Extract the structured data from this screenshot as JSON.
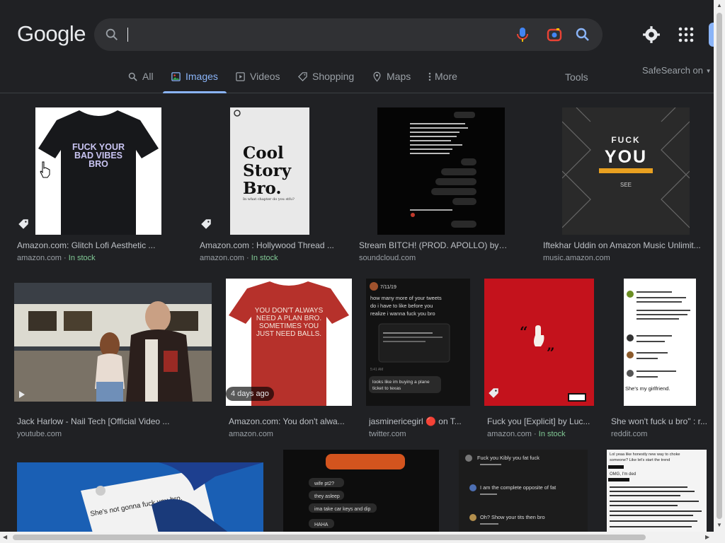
{
  "header": {
    "logo": "Google",
    "search": {
      "value": "",
      "placeholder": ""
    }
  },
  "tabs": [
    {
      "label": "All",
      "icon": "search-icon"
    },
    {
      "label": "Images",
      "icon": "image-icon",
      "active": true
    },
    {
      "label": "Videos",
      "icon": "play-icon"
    },
    {
      "label": "Shopping",
      "icon": "tag-icon"
    },
    {
      "label": "Maps",
      "icon": "map-pin-icon"
    },
    {
      "label": "More",
      "icon": "more-vert-icon"
    }
  ],
  "tools_label": "Tools",
  "safesearch_label": "SafeSearch on",
  "results": [
    {
      "title": "Amazon.com: Glitch Lofi Aesthetic ...",
      "source": "amazon.com",
      "stock": "In stock",
      "thumb_text": [
        "FUCK YOUR",
        "BAD VIBES",
        "BRO"
      ]
    },
    {
      "title": "Amazon.com : Hollywood Thread ...",
      "source": "amazon.com",
      "stock": "In stock",
      "thumb_text": [
        "Cool",
        "Story",
        "Bro.",
        "In what chapter do you stfu?"
      ]
    },
    {
      "title": "Stream BITCH! (PROD. APOLLO) by ...",
      "source": "soundcloud.com",
      "stock": ""
    },
    {
      "title": "Iftekhar Uddin on Amazon Music Unlimit...",
      "source": "music.amazon.com",
      "stock": "",
      "thumb_text": [
        "FUCK",
        "YOU",
        "SEE"
      ]
    },
    {
      "title": "Jack Harlow - Nail Tech [Official Video ...",
      "source": "youtube.com",
      "stock": ""
    },
    {
      "title": "Amazon.com: You don't alwa...",
      "source": "amazon.com",
      "stock": "",
      "badge": "4 days ago",
      "thumb_text": [
        "YOU DON'T ALWAYS",
        "NEED A PLAN BRO.",
        "SOMETIMES YOU",
        "JUST NEED BALLS."
      ]
    },
    {
      "title": "jasminericegirl 🔴 on T...",
      "source": "twitter.com",
      "stock": "",
      "thumb_text": [
        "how many more of your tweets",
        "do i have to like before you",
        "realize i wanna fuck you bro",
        "looks like im buying a plane",
        "ticket to texas"
      ]
    },
    {
      "title": "Fuck you [Explicit] by Luc...",
      "source": "amazon.com",
      "stock": "In stock"
    },
    {
      "title": "She won't fuck u bro\" : r...",
      "source": "reddit.com",
      "stock": "",
      "thumb_text": [
        "She's my girlfriend."
      ]
    },
    {
      "title": "",
      "source": "",
      "thumb_text": [
        "She's not gonna fuck you bro."
      ]
    },
    {
      "title": "",
      "source": "",
      "thumb_text": [
        "wife pt2?",
        "they asleep",
        "ima take car keys and dip",
        "HAHA"
      ]
    },
    {
      "title": "",
      "source": "",
      "thumb_text": [
        "Fuck you Kibly you fat fuck",
        "I am the complete opposite of fat",
        "Oh? Show your tits then bro"
      ]
    },
    {
      "title": "",
      "source": "",
      "thumb_text": [
        "Lol yeaa like honestly new way to choke",
        "someone? Like let's start the trend",
        "OMG, I'm ded"
      ]
    }
  ]
}
